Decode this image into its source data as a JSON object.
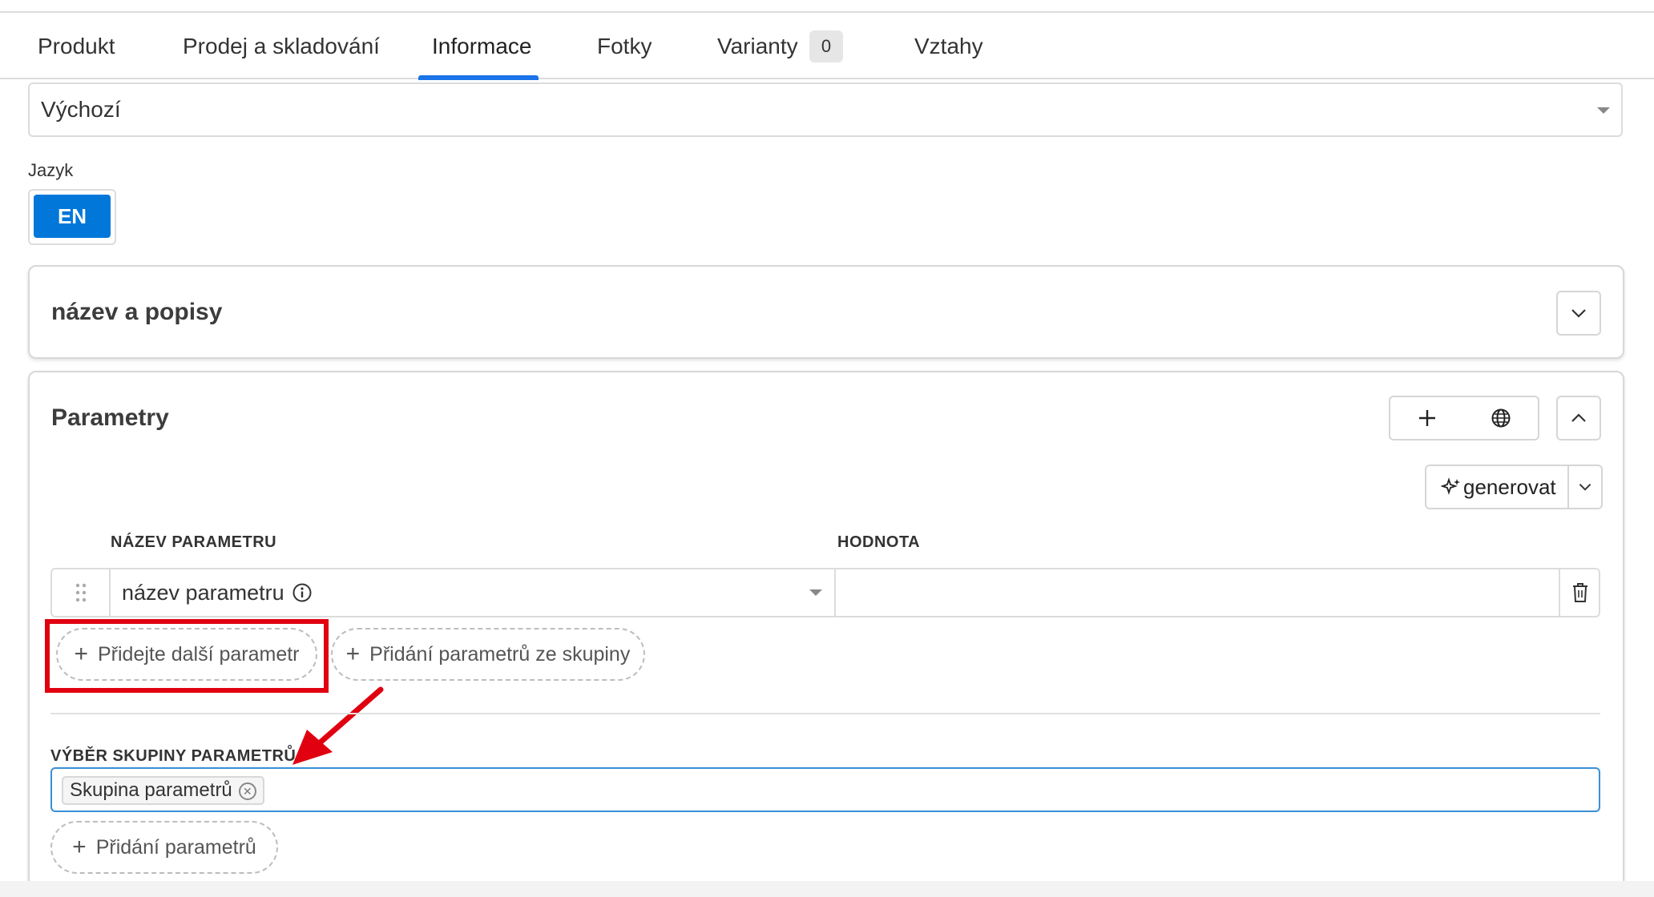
{
  "tabs": [
    {
      "label": "Produkt"
    },
    {
      "label": "Prodej a skladování"
    },
    {
      "label": "Informace",
      "active": true
    },
    {
      "label": "Fotky"
    },
    {
      "label": "Varianty",
      "badge": "0"
    },
    {
      "label": "Vztahy"
    }
  ],
  "template_select": {
    "value": "Výchozí"
  },
  "language": {
    "label": "Jazyk",
    "active": "EN"
  },
  "card_names": {
    "title": "název a popisy"
  },
  "card_params": {
    "title": "Parametry",
    "generate_label": "generovat",
    "col_name": "NÁZEV PARAMETRU",
    "col_value": "HODNOTA",
    "row": {
      "name_placeholder": "název parametru",
      "value": ""
    },
    "add_param_label": "Přidejte další parametr",
    "add_from_group_label": "Přidání parametrů ze skupiny",
    "group_section_label": "VÝBĚR SKUPINY PARAMETRŮ",
    "group_chip": "Skupina parametrů",
    "add_params_label": "Přidání parametrů"
  },
  "colors": {
    "accent": "#1a73e8",
    "lang_button": "#0077d9",
    "highlight": "#e00010"
  }
}
